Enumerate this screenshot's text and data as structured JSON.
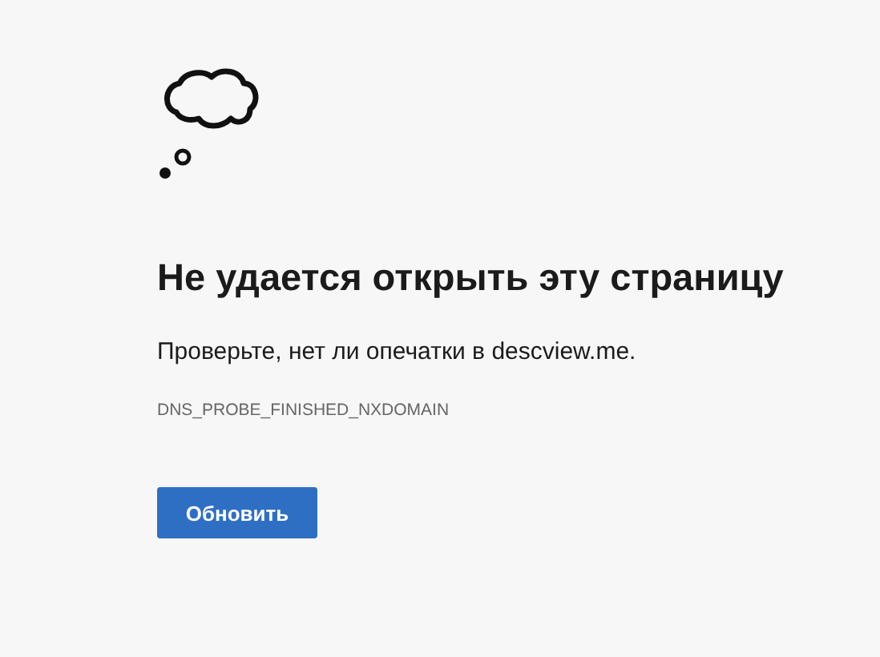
{
  "heading": "Не удается открыть эту страницу",
  "message": "Проверьте, нет ли опечатки в descview.me.",
  "error_code": "DNS_PROBE_FINISHED_NXDOMAIN",
  "button": "Обновить"
}
